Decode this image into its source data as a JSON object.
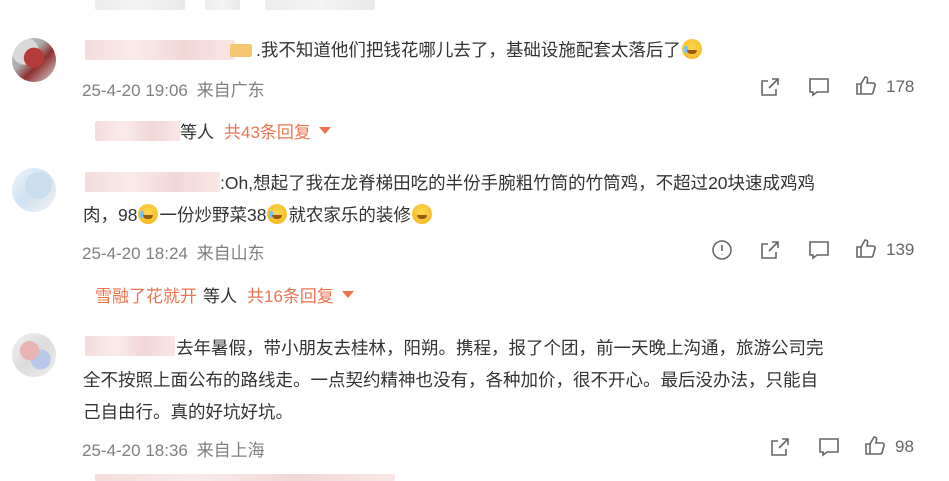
{
  "comments": [
    {
      "text": ".我不知道他们把钱花哪儿去了，基础设施配套太落后了",
      "time": "25-4-20 19:06",
      "location": "来自广东",
      "likes": "178",
      "reply_suffix": "等人",
      "reply_count": "共43条回复"
    },
    {
      "text_line1": ":Oh,想起了我在龙脊梯田吃的半份手腕粗竹筒的竹筒鸡，不超过20块速成鸡鸡",
      "text_line2_a": "肉，98",
      "text_line2_b": "一份炒野菜38",
      "text_line2_c": "就农家乐的装修",
      "time": "25-4-20 18:24",
      "location": "来自山东",
      "likes": "139",
      "reply_user": "雪融了花就开",
      "reply_suffix": "等人",
      "reply_count": "共16条回复"
    },
    {
      "text_line1": "去年暑假，带小朋友去桂林，阳朔。携程，报了个团，前一天晚上沟通，旅游公司完",
      "text_line2": "全不按照上面公布的路线走。一点契约精神也没有，各种加价，很不开心。最后没办法，只能自",
      "text_line3": "己自由行。真的好坑好坑。",
      "time": "25-4-20 18:36",
      "location": "来自上海",
      "likes": "98"
    }
  ],
  "icons": {
    "share": "share-icon",
    "comment": "comment-icon",
    "like": "thumbs-up-icon",
    "report": "report-icon",
    "expand": "triangle-down-icon"
  },
  "colors": {
    "accent": "#eb7350",
    "text": "#333333",
    "meta": "#808080"
  }
}
